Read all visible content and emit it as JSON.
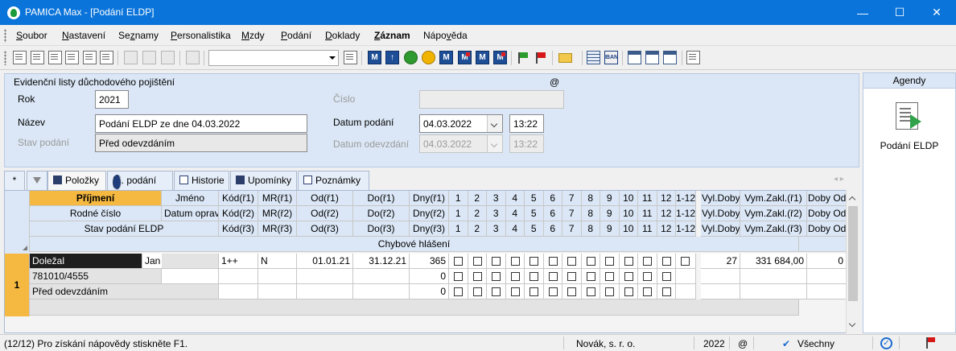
{
  "window": {
    "title": "PAMICA Max - [Podání ELDP]"
  },
  "menu": [
    {
      "pre": "",
      "u": "S",
      "post": "oubor"
    },
    {
      "pre": "",
      "u": "N",
      "post": "astavení"
    },
    {
      "pre": "Se",
      "u": "z",
      "post": "namy"
    },
    {
      "pre": "",
      "u": "P",
      "post": "ersonalistika"
    },
    {
      "pre": "",
      "u": "M",
      "post": "zdy"
    },
    {
      "pre": "",
      "u": "P",
      "post": "odání"
    },
    {
      "pre": "",
      "u": "D",
      "post": "oklady"
    },
    {
      "pre": "",
      "u": "Z",
      "post": "áznam"
    },
    {
      "pre": "Nápo",
      "u": "v",
      "post": "ěda"
    }
  ],
  "form": {
    "section_title": "Evidenční listy důchodového pojištění",
    "at_sign": "@",
    "rok_label": "Rok",
    "rok_value": "2021",
    "cislo_label": "Číslo",
    "cislo_value": "",
    "nazev_label": "Název",
    "nazev_value": "Podání ELDP ze dne 04.03.2022",
    "datum_podani_label": "Datum podání",
    "datum_podani_value": "04.03.2022",
    "cas_podani_value": "13:22",
    "stav_label": "Stav podání",
    "stav_value": "Před odevzdáním",
    "datum_odevzdani_label": "Datum odevzdání",
    "datum_odevzdani_value": "04.03.2022",
    "cas_odevzdani_value": "13:22"
  },
  "tabs": {
    "star": "*",
    "polozky": "Položky",
    "el_podani": "El. podání",
    "historie": "Historie",
    "upominky": "Upomínky",
    "poznamky": "Poznámky"
  },
  "grid": {
    "header1": [
      "Příjmení",
      "Jméno",
      "Kód(ř1)",
      "MR(ř1)",
      "Od(ř1)",
      "Do(ř1)",
      "Dny(ř1)"
    ],
    "header2": [
      "Rodné číslo",
      "Datum opravy",
      "Kód(ř2)",
      "MR(ř2)",
      "Od(ř2)",
      "Do(ř2)",
      "Dny(ř2)"
    ],
    "header3": [
      "Stav podání ELDP",
      "Kód(ř3)",
      "MR(ř3)",
      "Od(ř3)",
      "Do(ř3)",
      "Dny(ř3)"
    ],
    "months": [
      "1",
      "2",
      "3",
      "4",
      "5",
      "6",
      "7",
      "8",
      "9",
      "10",
      "11",
      "12",
      "1-12"
    ],
    "tail_headers1": [
      "Vyl.Doby",
      "Vym.Zakl.(ř1)",
      "Doby Od"
    ],
    "tail_headers2": [
      "Vyl.Doby",
      "Vym.Zakl.(ř2)",
      "Doby Od"
    ],
    "tail_headers3": [
      "Vyl.Doby",
      "Vym.Zakl.(ř3)",
      "Doby Od"
    ],
    "error_header": "Chybové hlášení",
    "row": {
      "num": "1",
      "prijmeni": "Doležal",
      "jmeno": "Jan",
      "kod1": "1++",
      "mr1": "N",
      "od1": "01.01.21",
      "do1": "31.12.21",
      "dny1": "365",
      "vyl_doby": "27",
      "vym_zakl": "331 684,00",
      "doby_od": "0",
      "rodne_cislo": "781010/4555",
      "dny2": "0",
      "stav": "Před odevzdáním",
      "dny3": "0"
    }
  },
  "agendy": {
    "title": "Agendy",
    "item": "Podání ELDP"
  },
  "status": {
    "help": "(12/12) Pro získání nápovědy stiskněte F1.",
    "company": "Novák, s. r. o.",
    "year": "2022",
    "at": "@",
    "filter": "Všechny"
  }
}
